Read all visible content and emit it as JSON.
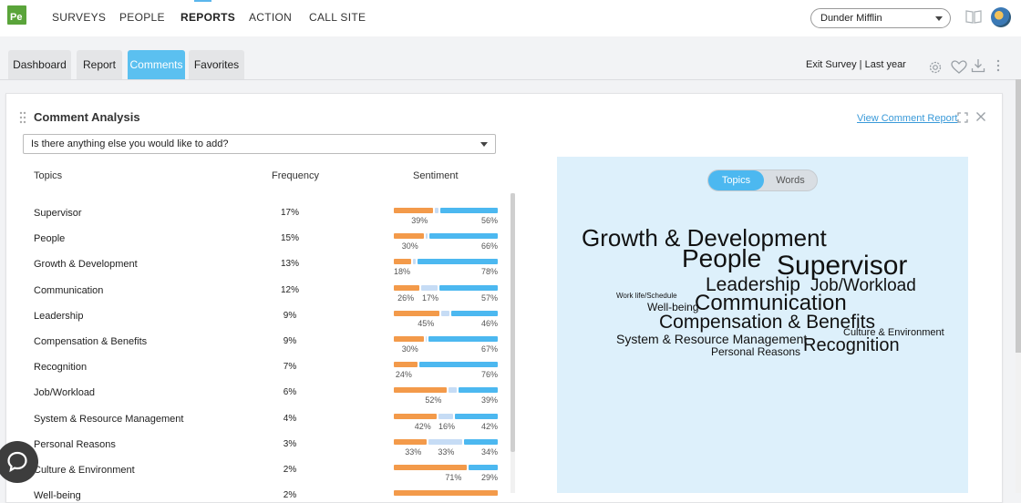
{
  "topbar": {
    "logo_text": "Pe",
    "nav": [
      {
        "label": "SURVEYS"
      },
      {
        "label": "PEOPLE"
      },
      {
        "label": "REPORTS"
      },
      {
        "label": "ACTION"
      },
      {
        "label": "CALL SITE"
      }
    ],
    "active_nav": "REPORTS",
    "company_select": "Dunder Mifflin"
  },
  "tabs": [
    {
      "label": "Dashboard"
    },
    {
      "label": "Report"
    },
    {
      "label": "Comments"
    },
    {
      "label": "Favorites"
    }
  ],
  "active_tab": "Comments",
  "survey_info": "Exit Survey | Last year",
  "toolbar_icons": [
    "settings-icon",
    "favorite-heart-icon",
    "download-icon",
    "more-vertical-icon"
  ],
  "card": {
    "title": "Comment Analysis",
    "view_link": "View Comment Report",
    "question": "Is there anything else you would like to add?",
    "columns": {
      "topics": "Topics",
      "frequency": "Frequency",
      "sentiment": "Sentiment"
    }
  },
  "rows": [
    {
      "topic": "Supervisor",
      "freq": "17%",
      "neg": 39,
      "neu": 5,
      "pos": 56,
      "labels": [
        "39%",
        "",
        "56%"
      ]
    },
    {
      "topic": "People",
      "freq": "15%",
      "neg": 30,
      "neu": 4,
      "pos": 66,
      "labels": [
        "30%",
        "",
        "66%"
      ]
    },
    {
      "topic": "Growth & Development",
      "freq": "13%",
      "neg": 18,
      "neu": 4,
      "pos": 78,
      "labels": [
        "18%",
        "",
        "78%"
      ]
    },
    {
      "topic": "Communication",
      "freq": "12%",
      "neg": 26,
      "neu": 17,
      "pos": 57,
      "labels": [
        "26%",
        "17%",
        "57%"
      ]
    },
    {
      "topic": "Leadership",
      "freq": "9%",
      "neg": 45,
      "neu": 9,
      "pos": 46,
      "labels": [
        "45%",
        "",
        "46%"
      ]
    },
    {
      "topic": "Compensation & Benefits",
      "freq": "9%",
      "neg": 30,
      "neu": 3,
      "pos": 67,
      "labels": [
        "30%",
        "",
        "67%"
      ]
    },
    {
      "topic": "Recognition",
      "freq": "7%",
      "neg": 24,
      "neu": 0,
      "pos": 76,
      "labels": [
        "24%",
        "",
        "76%"
      ]
    },
    {
      "topic": "Job/Workload",
      "freq": "6%",
      "neg": 52,
      "neu": 9,
      "pos": 39,
      "labels": [
        "52%",
        "",
        "39%"
      ]
    },
    {
      "topic": "System & Resource Management",
      "freq": "4%",
      "neg": 42,
      "neu": 16,
      "pos": 42,
      "labels": [
        "42%",
        "16%",
        "42%"
      ]
    },
    {
      "topic": "Personal Reasons",
      "freq": "3%",
      "neg": 33,
      "neu": 33,
      "pos": 34,
      "labels": [
        "33%",
        "33%",
        "34%"
      ]
    },
    {
      "topic": "Culture & Environment",
      "freq": "2%",
      "neg": 71,
      "neu": 0,
      "pos": 29,
      "labels": [
        "71%",
        "",
        "29%"
      ]
    },
    {
      "topic": "Well-being",
      "freq": "2%",
      "neg": 100,
      "neu": 0,
      "pos": 0,
      "labels": [
        "",
        "",
        ""
      ]
    }
  ],
  "cloud": {
    "toggle": [
      "Topics",
      "Words"
    ],
    "active_toggle": "Topics",
    "words": [
      "Growth & Development",
      "People",
      "Supervisor",
      "Leadership",
      "Job/Workload",
      "Work life/Schedule",
      "Communication",
      "Well-being",
      "Compensation & Benefits",
      "Culture & Environment",
      "System & Resource Management",
      "Recognition",
      "Personal Reasons"
    ]
  },
  "colors": {
    "accent": "#5bc0f0",
    "negative": "#f39a4a",
    "neutral": "#c6dcf5",
    "positive": "#4cb8f0",
    "cloud_bg": "#ddf0fb"
  }
}
